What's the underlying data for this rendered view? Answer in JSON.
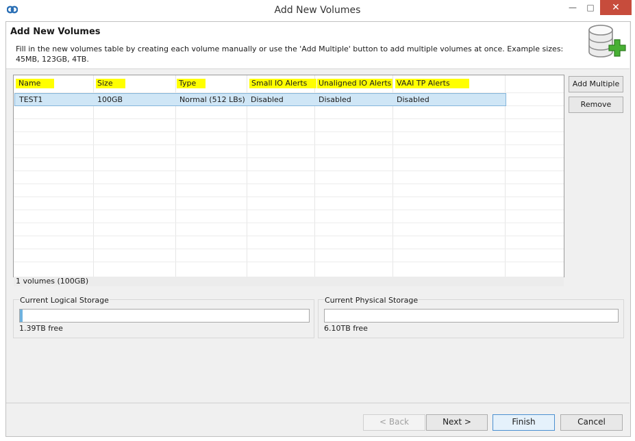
{
  "window": {
    "title": "Add New Volumes",
    "minimize": "—",
    "maximize": "□",
    "close": "✕"
  },
  "header": {
    "title": "Add New Volumes",
    "description": "Fill in the new volumes table by creating each volume manually or use the 'Add Multiple' button to add multiple volumes at once. Example sizes: 45MB, 123GB, 4TB.",
    "icon": "database-add-icon"
  },
  "table": {
    "columns": [
      "Name",
      "Size",
      "Type",
      "Small IO Alerts",
      "Unaligned IO Alerts",
      "VAAI TP Alerts"
    ],
    "rows": [
      {
        "name": "TEST1",
        "size": "100GB",
        "type": "Normal (512 LBs)",
        "small_io_alerts": "Disabled",
        "unaligned_io_alerts": "Disabled",
        "vaai_tp_alerts": "Disabled"
      }
    ],
    "status": "1 volumes (100GB)"
  },
  "side_buttons": {
    "add_multiple": "Add Multiple",
    "remove": "Remove"
  },
  "storage": {
    "logical": {
      "label": "Current Logical Storage",
      "free": "1.39TB free",
      "used_fraction": 0.003
    },
    "physical": {
      "label": "Current Physical Storage",
      "free": "6.10TB free",
      "used_fraction": 0.0
    }
  },
  "footer": {
    "back": "< Back",
    "next": "Next >",
    "finish": "Finish",
    "cancel": "Cancel"
  },
  "colors": {
    "highlight": "#ffff00",
    "selected_row": "#cfe6f6",
    "close_button": "#c74c3c"
  }
}
